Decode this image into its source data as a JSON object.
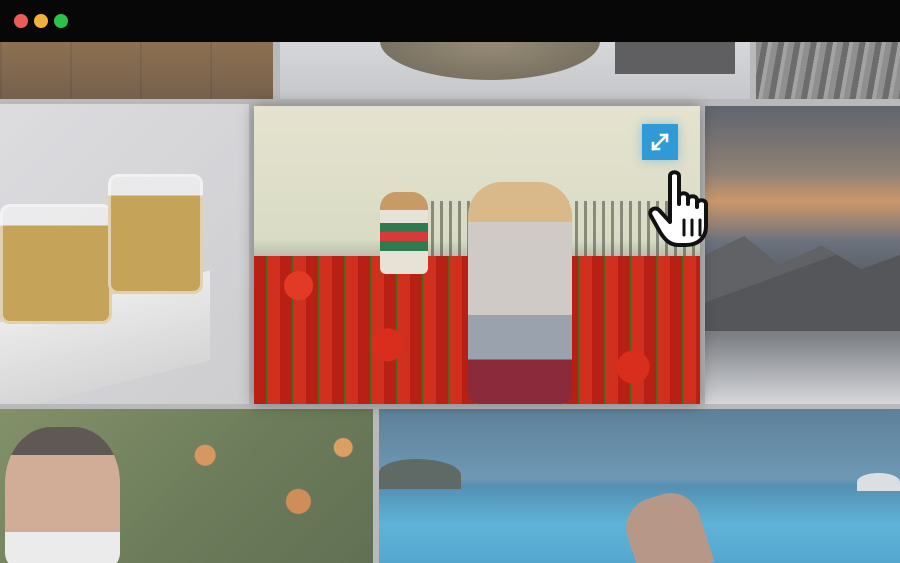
{
  "window": {
    "controls": [
      "close",
      "minimize",
      "maximize"
    ],
    "colors": {
      "close": "#ec5b55",
      "minimize": "#f2b13b",
      "maximize": "#2bc24a",
      "titlebar": "#070707"
    }
  },
  "gallery": {
    "tiles": [
      {
        "subject": "wooden-surface"
      },
      {
        "subject": "doormat-on-floor"
      },
      {
        "subject": "gray-drapery"
      },
      {
        "subject": "honey-jars"
      },
      {
        "subject": "children-in-tulip-field",
        "state": "highlighted"
      },
      {
        "subject": "sunset-mountain-lake"
      },
      {
        "subject": "man-in-flower-field"
      },
      {
        "subject": "beach-swimmer"
      }
    ],
    "expand_button": {
      "icon": "expand-arrows-icon",
      "color": "#2f9ad6"
    },
    "cursor": {
      "icon": "hand-pointer-cursor"
    }
  }
}
